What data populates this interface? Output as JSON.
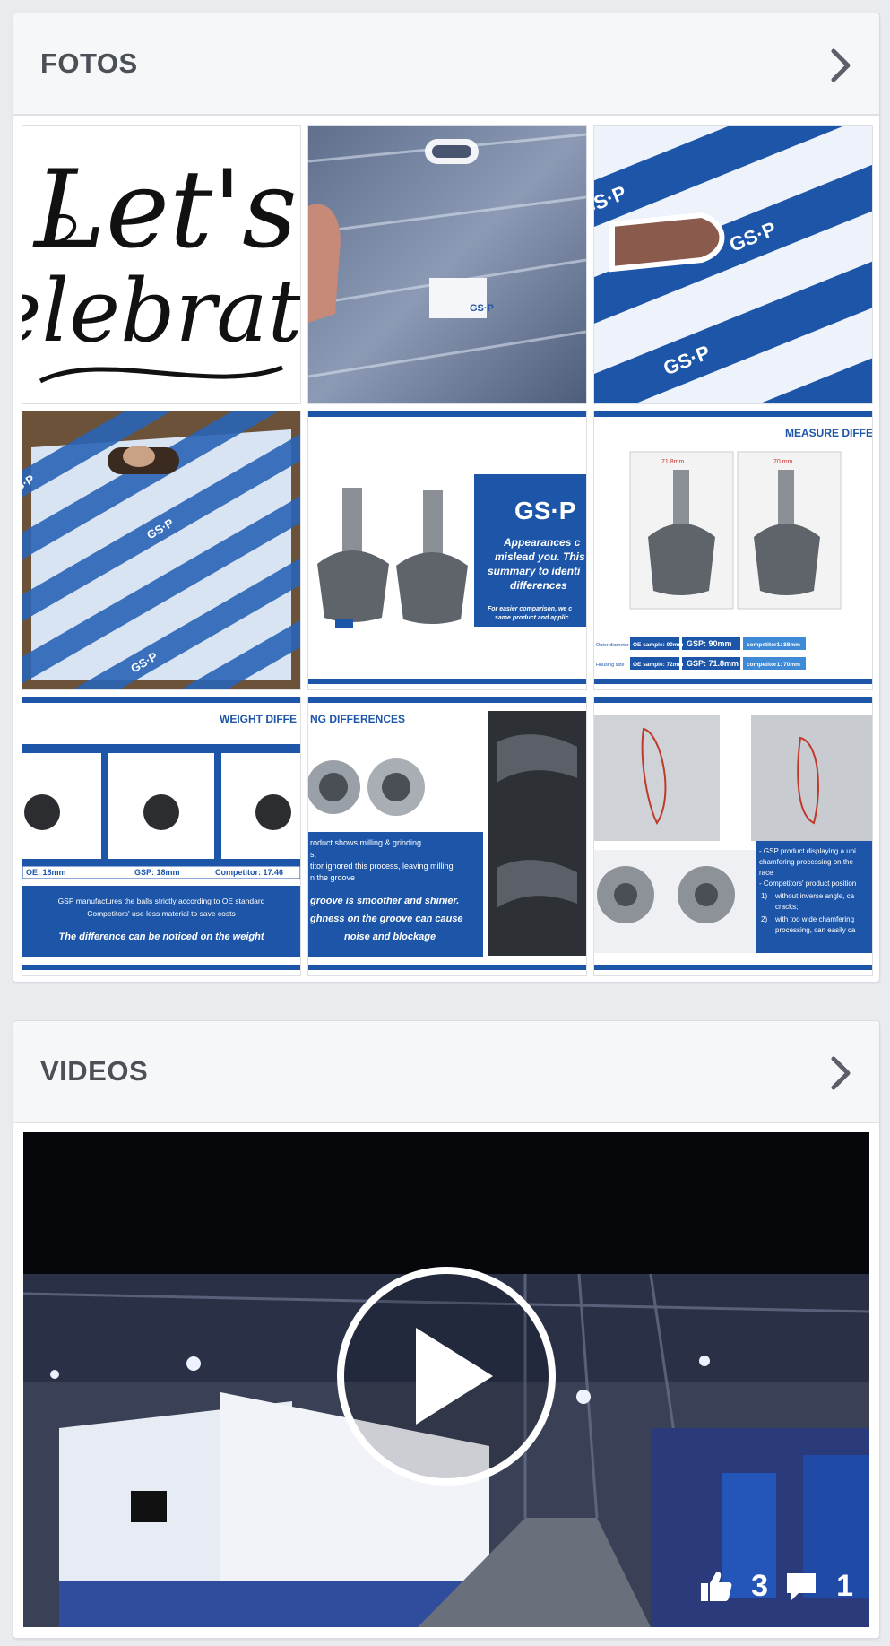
{
  "photos": {
    "title": "FOTOS",
    "tiles": [
      {
        "caption_lines": [
          "Let's",
          "celebrate"
        ]
      },
      {
        "caption_lines": [
          "GS·P"
        ]
      },
      {
        "caption_lines": [
          "GS·P"
        ]
      },
      {
        "caption_lines": [
          "GS·P"
        ]
      },
      {
        "caption_lines": [
          "GS·P",
          "Appearances c",
          "mislead you. This",
          "summary to identi",
          "differences",
          "For easier comparison, we c",
          "same product and applic"
        ]
      },
      {
        "caption_lines": [
          "MEASURE DIFFE",
          "71.8mm",
          "70 mm",
          "OE sample: 90mm",
          "GSP: 90mm",
          "competitor1: 88mm",
          "OE sample: 72mm",
          "GSP: 71.8mm",
          "competitor1: 70mm",
          "Outer diameter",
          "Housing size"
        ]
      },
      {
        "caption_lines": [
          "WEIGHT DIFFE",
          "OE: 18mm",
          "GSP: 18mm",
          "Competitor: 17.46",
          "GSP manufactures the balls strictly according to OE standard",
          "Competitors' use less material to save costs",
          "The difference can be noticed on the weight"
        ]
      },
      {
        "caption_lines": [
          "NG DIFFERENCES",
          "roduct shows milling & grinding",
          "s;",
          "titor ignored this process, leaving milling",
          "n the groove",
          "groove is smoother and shinier.",
          "ghness on the groove can cause",
          "noise and blockage"
        ]
      },
      {
        "caption_lines": [
          "- GSP product displaying a uni",
          "chamfering processing on the",
          "race",
          "- Competitors' product position",
          "1)",
          "without inverse angle, ca",
          "cracks;",
          "2)",
          "with too wide chamfering",
          "processing, can easily ca"
        ]
      }
    ]
  },
  "videos": {
    "title": "VIDEOS",
    "likes": "3",
    "comments": "1"
  },
  "colors": {
    "page_bg": "#e9ebee",
    "header_bg": "#f6f7f9",
    "title": "#4b4f56",
    "gsp_blue": "#1d56a8"
  }
}
